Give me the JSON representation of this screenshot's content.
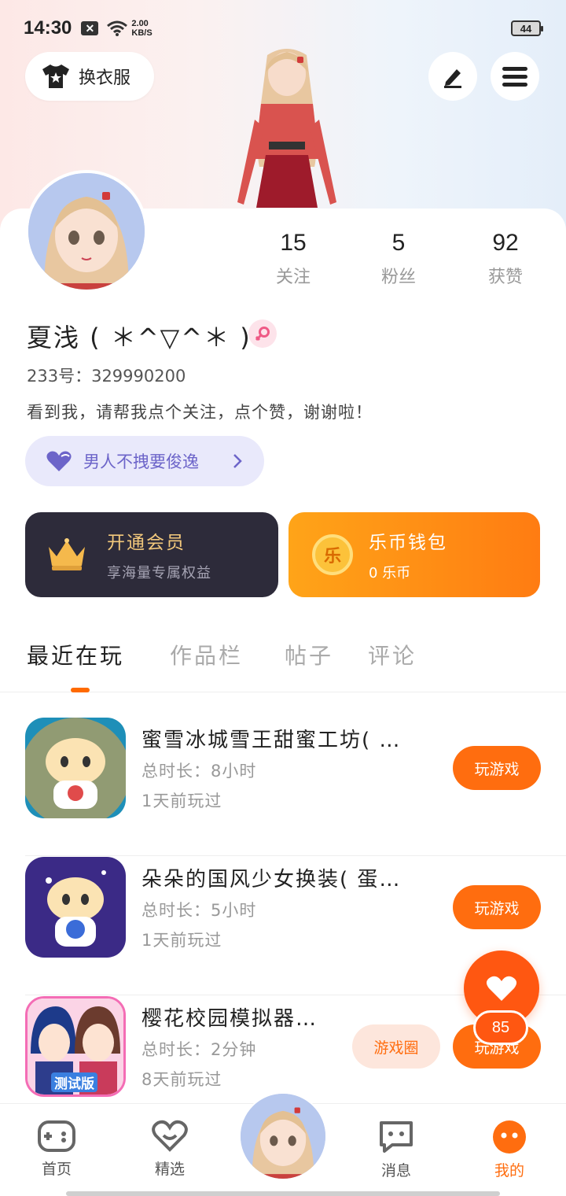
{
  "status_bar": {
    "time": "14:30",
    "speed_top": "2.00",
    "speed_bottom": "KB/S",
    "battery": "44"
  },
  "header": {
    "outfit_label": "换衣服",
    "edit_icon": "pencil-icon",
    "menu_icon": "menu-icon"
  },
  "profile": {
    "stats": [
      {
        "value": "15",
        "label": "关注"
      },
      {
        "value": "5",
        "label": "粉丝"
      },
      {
        "value": "92",
        "label": "获赞"
      }
    ],
    "nickname": "夏浅 ( ＊^▽^＊ )",
    "uid": "233号：329990200",
    "bio": "看到我，请帮我点个关注，点个赞，谢谢啦！",
    "tag": "男人不拽要俊逸"
  },
  "cards": {
    "vip_title": "开通会员",
    "vip_sub": "享海量专属权益",
    "coin_title": "乐币钱包",
    "coin_sub": "0 乐币",
    "coin_glyph": "乐"
  },
  "tabs": [
    "最近在玩",
    "作品栏",
    "帖子",
    "评论"
  ],
  "games": [
    {
      "name": "蜜雪冰城雪王甜蜜工坊( …",
      "duration": "总时长：8小时",
      "last_played": "1天前玩过",
      "play": "玩游戏",
      "circle": ""
    },
    {
      "name": "朵朵的国风少女换装( 蛋…",
      "duration": "总时长：5小时",
      "last_played": "1天前玩过",
      "play": "玩游戏",
      "circle": ""
    },
    {
      "name": "樱花校园模拟器…",
      "duration": "总时长：2分钟",
      "last_played": "8天前玩过",
      "play": "玩游戏",
      "circle": "游戏圈"
    }
  ],
  "game_icon_text": "测试版",
  "like_count": "85",
  "bottom_nav": [
    {
      "label": "首页"
    },
    {
      "label": "精选"
    },
    {
      "label": "消息"
    },
    {
      "label": "我的"
    }
  ],
  "colors": {
    "accent": "#ff6d0f",
    "vip_bg": "#2d2b3a",
    "tag_text": "#6c64c9"
  }
}
